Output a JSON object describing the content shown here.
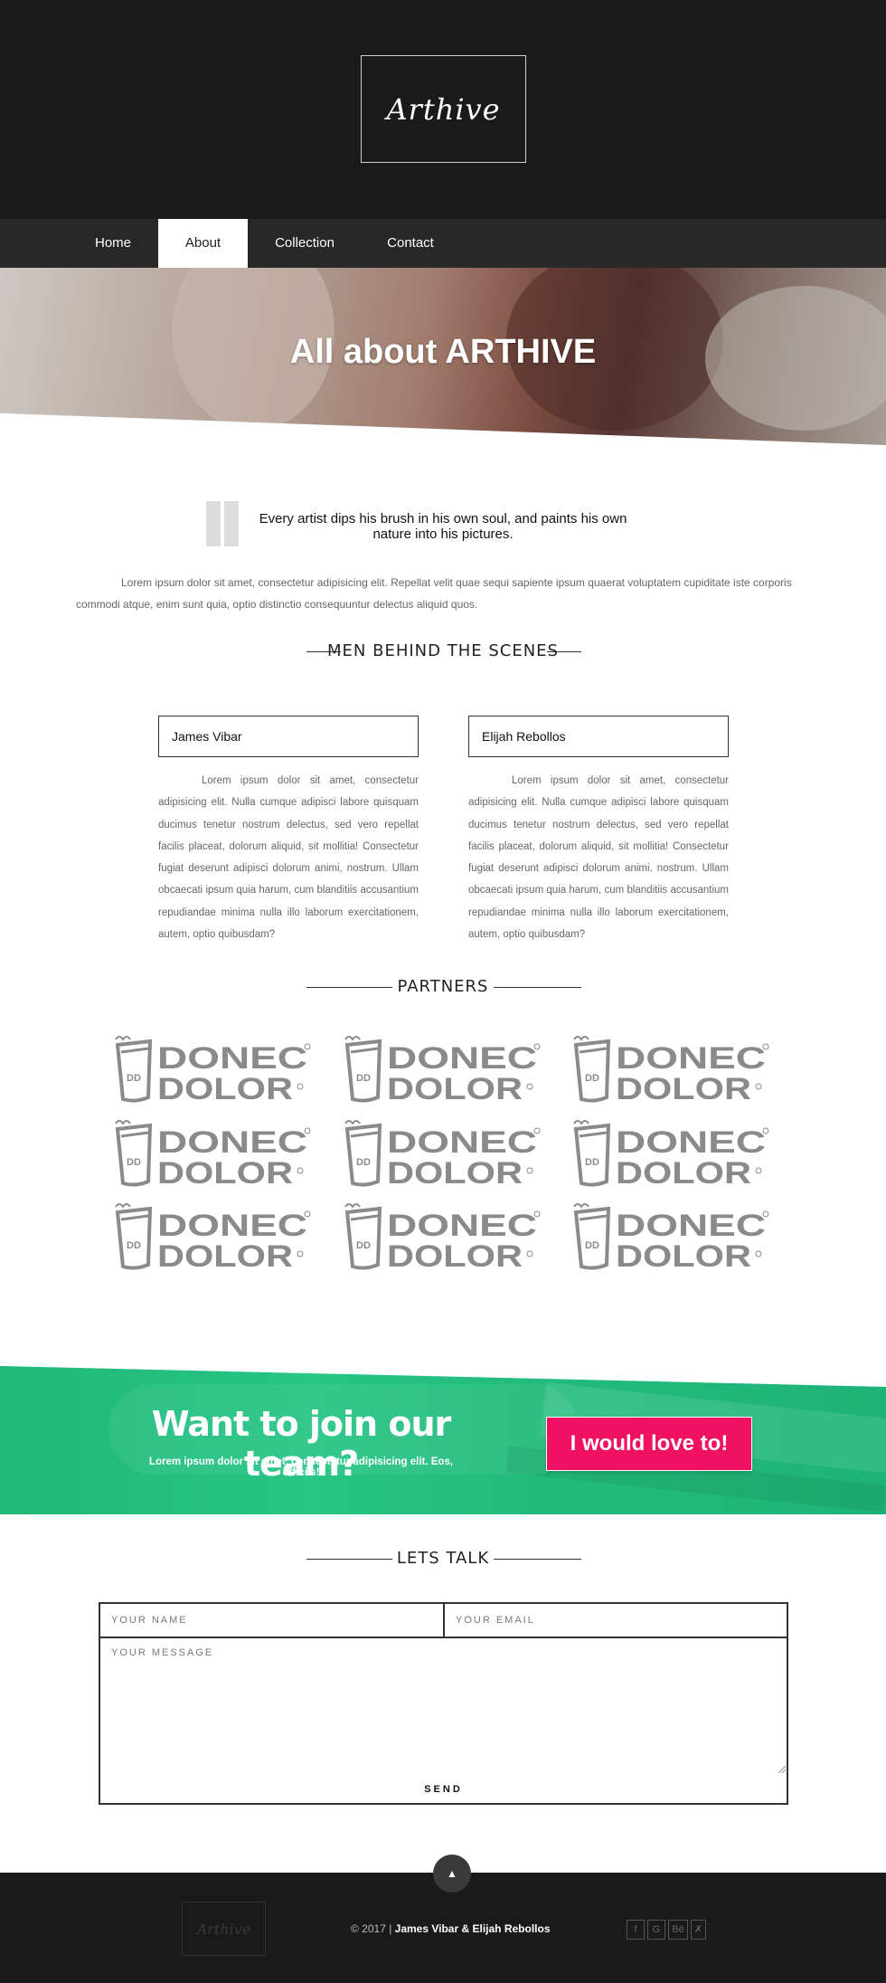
{
  "brand": {
    "logo": "Arthive"
  },
  "nav": {
    "items": [
      {
        "label": "Home"
      },
      {
        "label": "About"
      },
      {
        "label": "Collection"
      },
      {
        "label": "Contact"
      }
    ],
    "active": "About"
  },
  "hero": {
    "title": "All about ARTHIVE"
  },
  "quote": {
    "text": "Every artist dips his brush in his own soul, and paints his own nature into his pictures."
  },
  "intro": {
    "text": "Lorem ipsum dolor sit amet, consectetur adipisicing elit. Repellat velit quae sequi sapiente ipsum quaerat voluptatem cupiditate iste corporis commodi atque, enim sunt quia, optio distinctio consequuntur delectus aliquid quos."
  },
  "team": {
    "heading": "MEN BEHIND THE SCENES",
    "members": [
      {
        "name": "James Vibar",
        "bio": "Lorem ipsum dolor sit amet, consectetur adipisicing elit. Nulla cumque adipisci labore quisquam ducimus tenetur nostrum delectus, sed vero repellat facilis placeat, dolorum aliquid, sit mollitia! Consectetur fugiat deserunt adipisci dolorum animi, nostrum. Ullam obcaecati ipsum quia harum, cum blanditiis accusantium repudiandae minima nulla illo laborum exercitationem, autem, optio quibusdam?"
      },
      {
        "name": "Elijah Rebollos",
        "bio": "Lorem ipsum dolor sit amet, consectetur adipisicing elit. Nulla cumque adipisci labore quisquam ducimus tenetur nostrum delectus, sed vero repellat facilis placeat, dolorum aliquid, sit mollitia! Consectetur fugiat deserunt adipisci dolorum animi, nostrum. Ullam obcaecati ipsum quia harum, cum blanditiis accusantium repudiandae minima nulla illo laborum exercitationem, autem, optio quibusdam?"
      }
    ]
  },
  "partners": {
    "heading": "PARTNERS",
    "logo_line1": "DONEC",
    "logo_line2": "DOLOR",
    "logo_cup": "DD",
    "count": 9
  },
  "join": {
    "title": "Want to join our team?",
    "subtitle": "Lorem ipsum dolor sit amet, consectetur adipisicing elit. Eos, officiis!",
    "button": "I would love to!"
  },
  "contact": {
    "heading": "LETS TALK",
    "name_placeholder": "YOUR NAME",
    "email_placeholder": "YOUR EMAIL",
    "message_placeholder": "YOUR MESSAGE",
    "send_label": "SEND"
  },
  "footer": {
    "logo": "Arthive",
    "copyright": "© 2017 | ",
    "authors": "James Vibar & Elijah Rebollos",
    "social": [
      {
        "icon": "facebook-icon",
        "label": "f"
      },
      {
        "icon": "google-icon",
        "label": "G"
      },
      {
        "icon": "behance-icon",
        "label": "Bē"
      },
      {
        "icon": "xing-icon",
        "label": "✗"
      }
    ]
  },
  "colors": {
    "header_bg": "#1b1a1b",
    "nav_bg": "#282828",
    "accent_green": "#22bb7d",
    "cta_pink": "#f01162"
  }
}
